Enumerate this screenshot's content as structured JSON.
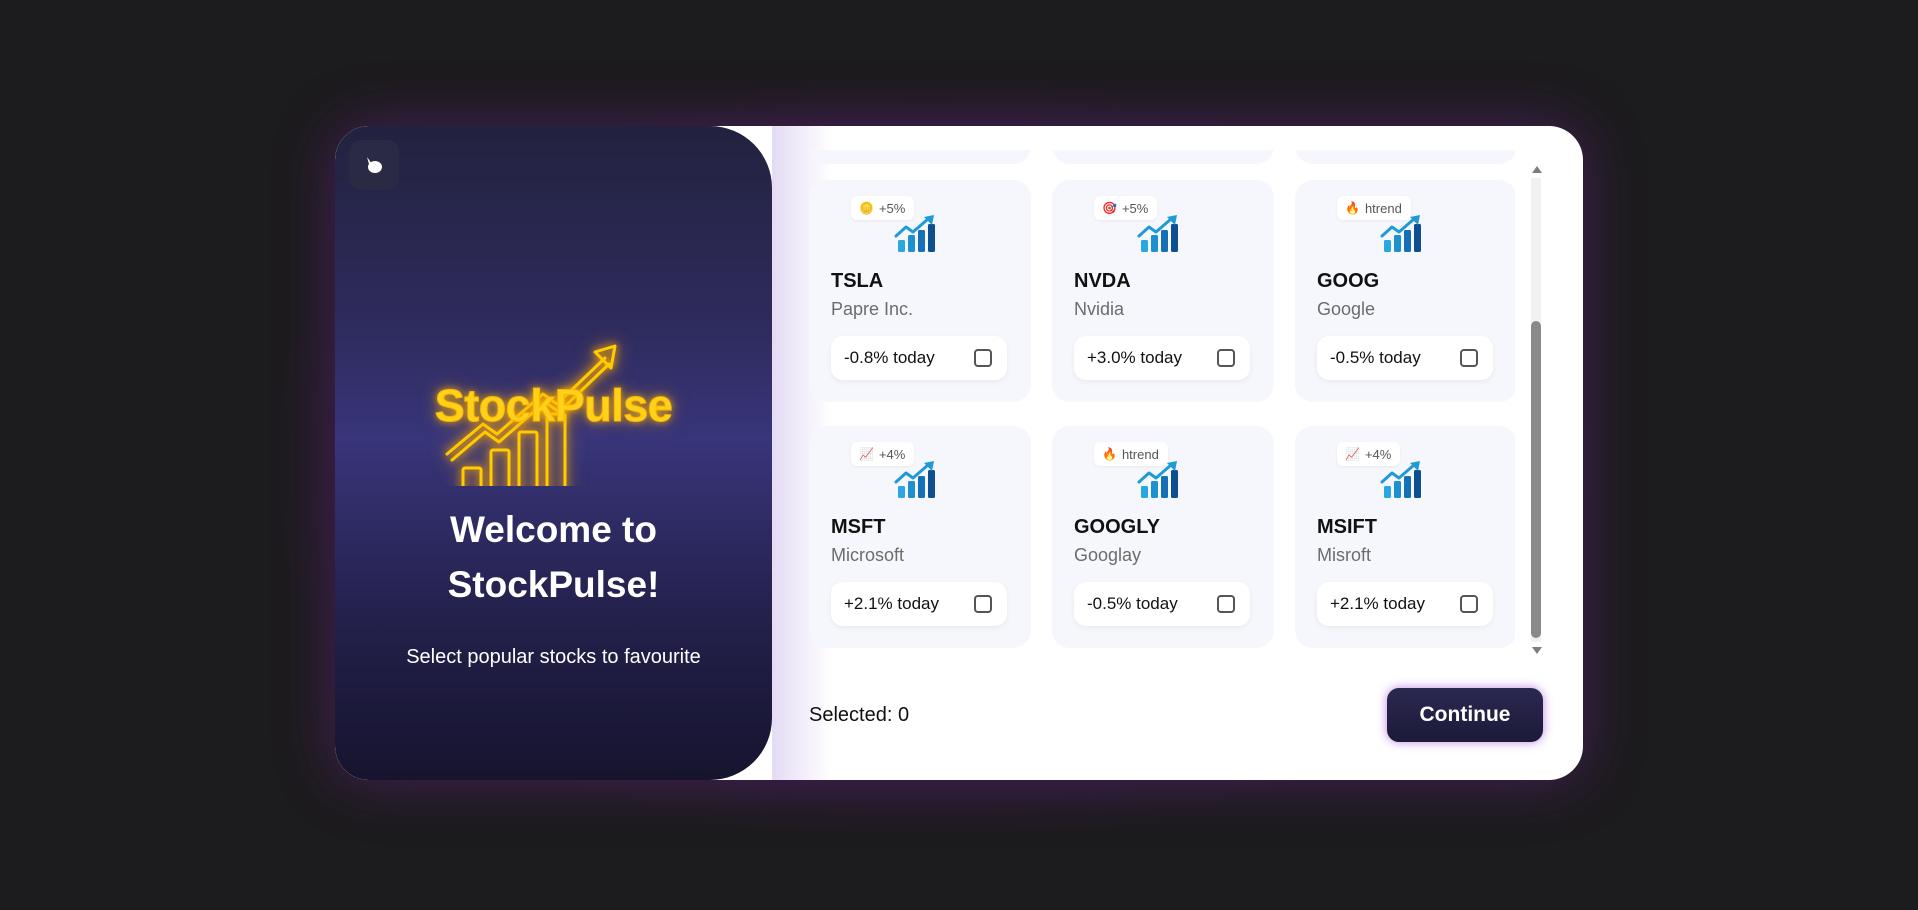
{
  "left_panel": {
    "back_icon": "cursor-pointer-icon",
    "brand": "StockPulse",
    "welcome_line1": "Welcome to",
    "welcome_line2": "StockPulse!",
    "subtitle": "Select popular stocks to favourite"
  },
  "stocks": [
    {
      "badge_icon": "coin-icon",
      "badge_emoji": "🪙",
      "badge": "+5%",
      "ticker": "TSLA",
      "company": "Papre Inc.",
      "change": "-0.8% today",
      "checked": false
    },
    {
      "badge_icon": "target-icon",
      "badge_emoji": "🎯",
      "badge": "+5%",
      "ticker": "NVDA",
      "company": "Nvidia",
      "change": "+3.0% today",
      "checked": false
    },
    {
      "badge_icon": "fire-icon",
      "badge_emoji": "🔥",
      "badge": "htrend",
      "ticker": "GOOG",
      "company": "Google",
      "change": "-0.5% today",
      "checked": false
    },
    {
      "badge_icon": "chart-increasing-icon",
      "badge_emoji": "📈",
      "badge": "+4%",
      "ticker": "MSFT",
      "company": "Microsoft",
      "change": "+2.1% today",
      "checked": false
    },
    {
      "badge_icon": "fire-icon",
      "badge_emoji": "🔥",
      "badge": "htrend",
      "ticker": "GOOGLY",
      "company": "Googlay",
      "change": "-0.5% today",
      "checked": false
    },
    {
      "badge_icon": "chart-increasing-icon",
      "badge_emoji": "📈",
      "badge": "+4%",
      "ticker": "MSIFT",
      "company": "Misroft",
      "change": "+2.1% today",
      "checked": false
    }
  ],
  "footer": {
    "selected": "Selected: 0",
    "continue": "Continue"
  },
  "colors": {
    "brand_neon": "#ffd21a",
    "panel_dark": "#22223f",
    "button_dark": "#1c1a38",
    "chart_blue": "#1e9ad6"
  }
}
